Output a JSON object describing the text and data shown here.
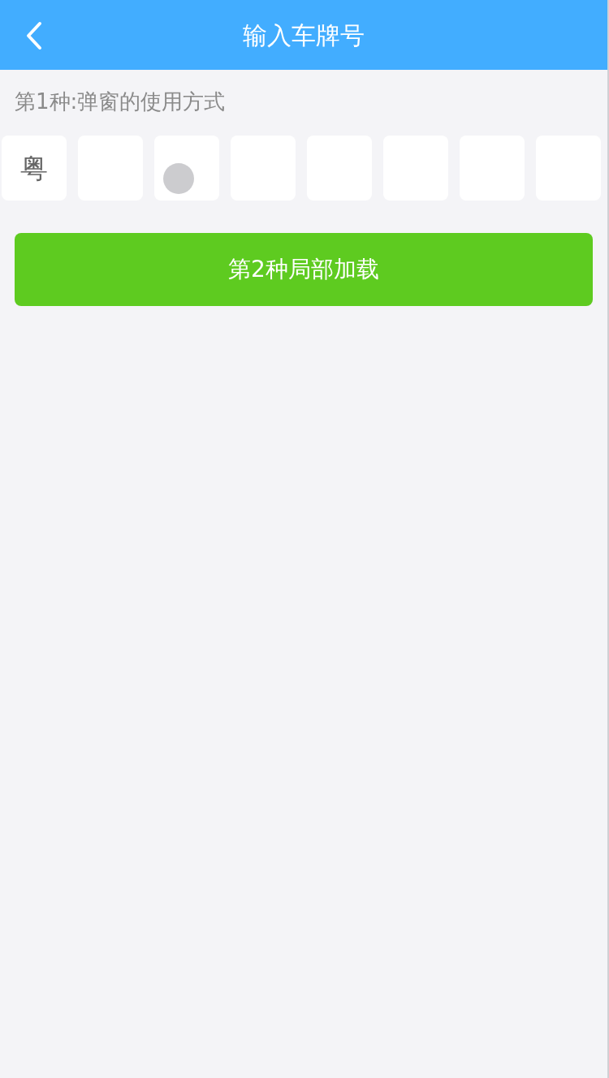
{
  "header": {
    "title": "输入车牌号"
  },
  "section": {
    "label": "第1种:弹窗的使用方式"
  },
  "plate_cells": [
    {
      "kind": "filled",
      "value": "粤",
      "touched": false
    },
    {
      "kind": "empty",
      "touched": false
    },
    {
      "kind": "empty",
      "touched": true
    },
    {
      "kind": "empty",
      "touched": false
    },
    {
      "kind": "empty",
      "touched": false
    },
    {
      "kind": "empty",
      "touched": false
    },
    {
      "kind": "empty",
      "touched": false
    },
    {
      "kind": "empty",
      "touched": false
    }
  ],
  "button": {
    "label": "第2种局部加载"
  }
}
